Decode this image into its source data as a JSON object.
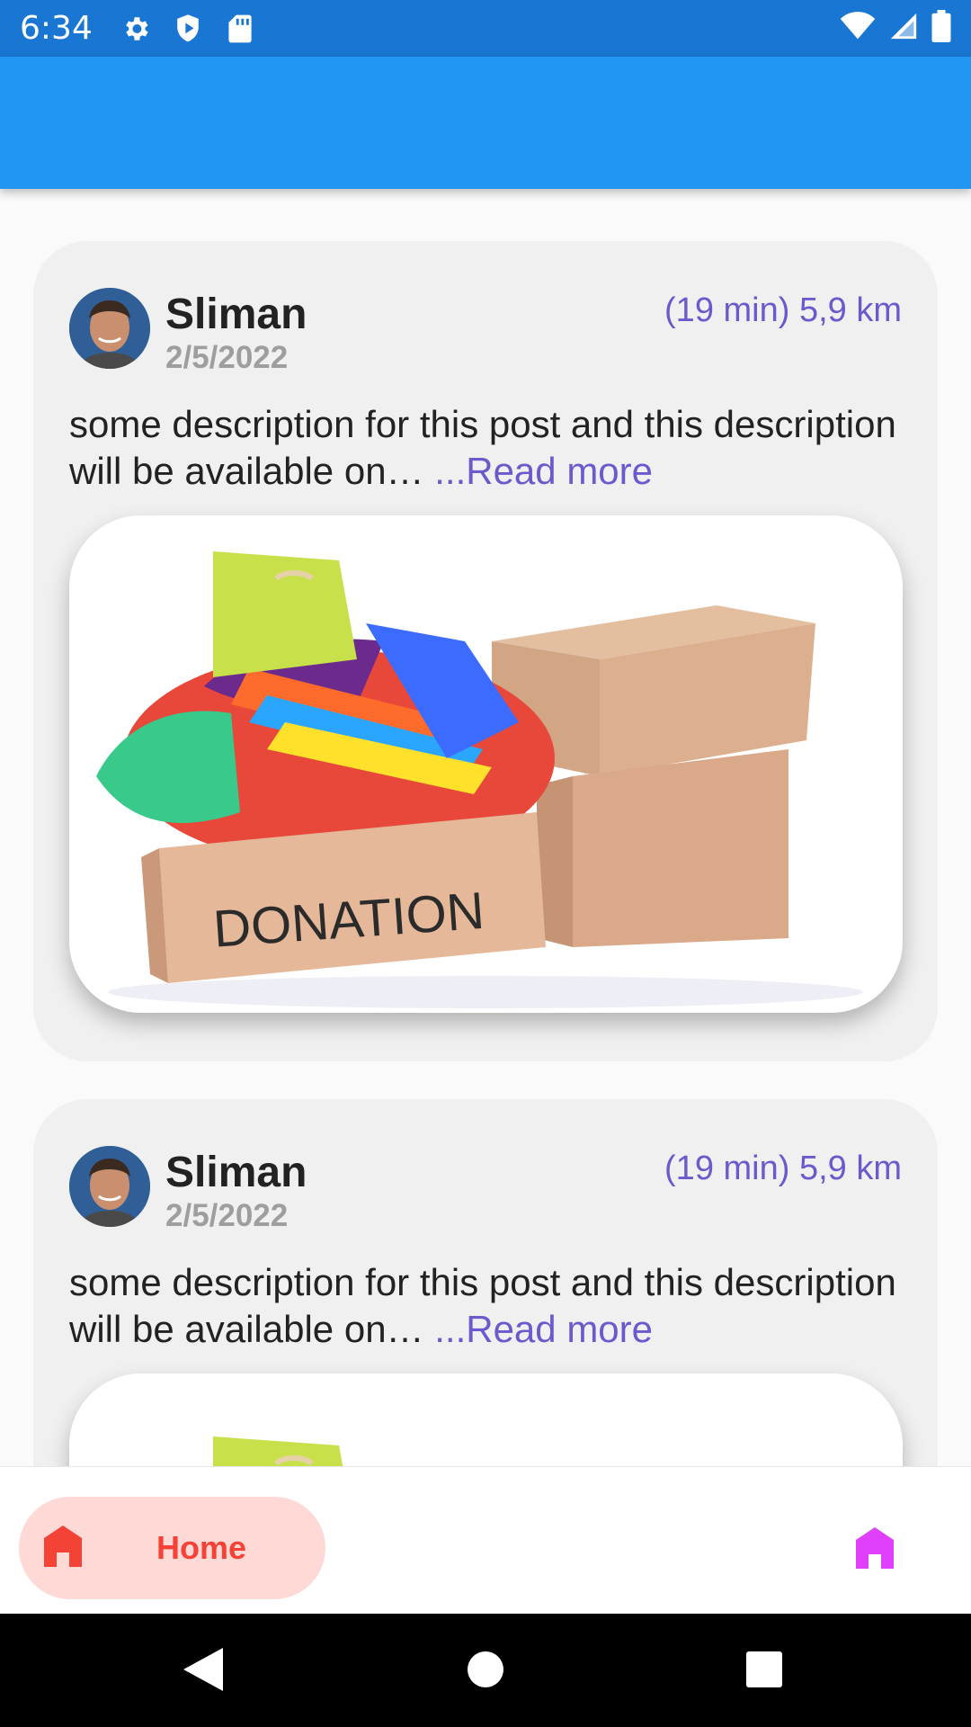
{
  "status_bar": {
    "time": "6:34",
    "icons": [
      "gear-icon",
      "shield-play-icon",
      "sd-card-icon",
      "wifi-icon",
      "signal-icon",
      "battery-icon"
    ]
  },
  "posts": [
    {
      "user_name": "Sliman",
      "date": "2/5/2022",
      "distance": "(19 min) 5,9 km",
      "description": "some description for this post and this description will be available on…",
      "read_more": " ...Read more",
      "image_alt_text": "DONATION"
    },
    {
      "user_name": "Sliman",
      "date": "2/5/2022",
      "distance": "(19 min) 5,9 km",
      "description": "some description for this post and this description will be available on…",
      "read_more": " ...Read more"
    }
  ],
  "bottom_nav": {
    "home_label": "Home",
    "active_color": "#f44336",
    "active_bg": "#ffd9d5",
    "second_icon_color": "#e040fb"
  },
  "colors": {
    "status_bar": "#1976d2",
    "app_bar": "#2196f3",
    "accent_text": "#6a5acd"
  }
}
